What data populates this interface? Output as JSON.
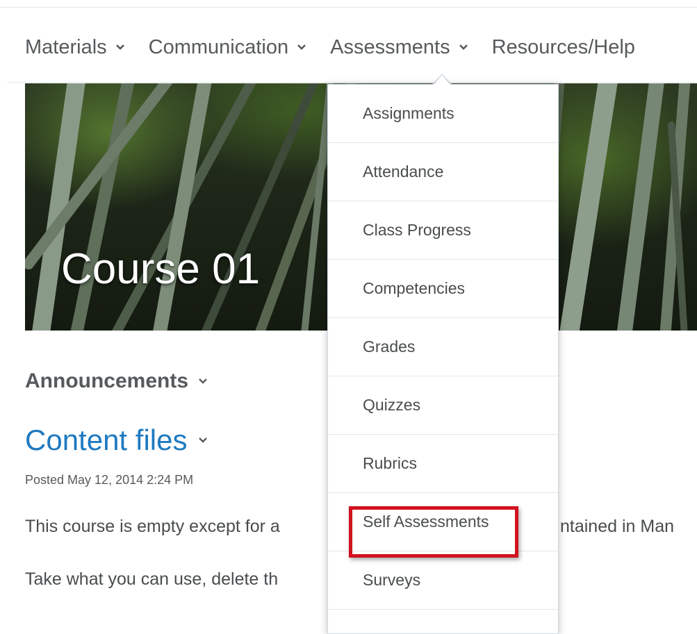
{
  "nav": {
    "items": [
      {
        "label": "Materials"
      },
      {
        "label": "Communication"
      },
      {
        "label": "Assessments"
      },
      {
        "label": "Resources/Help"
      }
    ]
  },
  "banner": {
    "title": "Course 01"
  },
  "dropdown": {
    "items": [
      {
        "label": "Assignments"
      },
      {
        "label": "Attendance"
      },
      {
        "label": "Class Progress"
      },
      {
        "label": "Competencies"
      },
      {
        "label": "Grades"
      },
      {
        "label": "Quizzes"
      },
      {
        "label": "Rubrics"
      },
      {
        "label": "Self Assessments"
      },
      {
        "label": "Surveys"
      }
    ],
    "highlighted_item": "Self Assessments",
    "highlight_color": "#d1121e"
  },
  "widgets": {
    "announcements_label": "Announcements",
    "content_title": "Content files",
    "posted": "Posted May 12, 2014 2:24 PM",
    "paragraph1_start": "This course is empty except for a",
    "paragraph1_end": "ntained in Man",
    "paragraph2": "Take what you can use, delete th"
  },
  "colors": {
    "link": "#1e7ac0",
    "text": "#494c4e"
  }
}
